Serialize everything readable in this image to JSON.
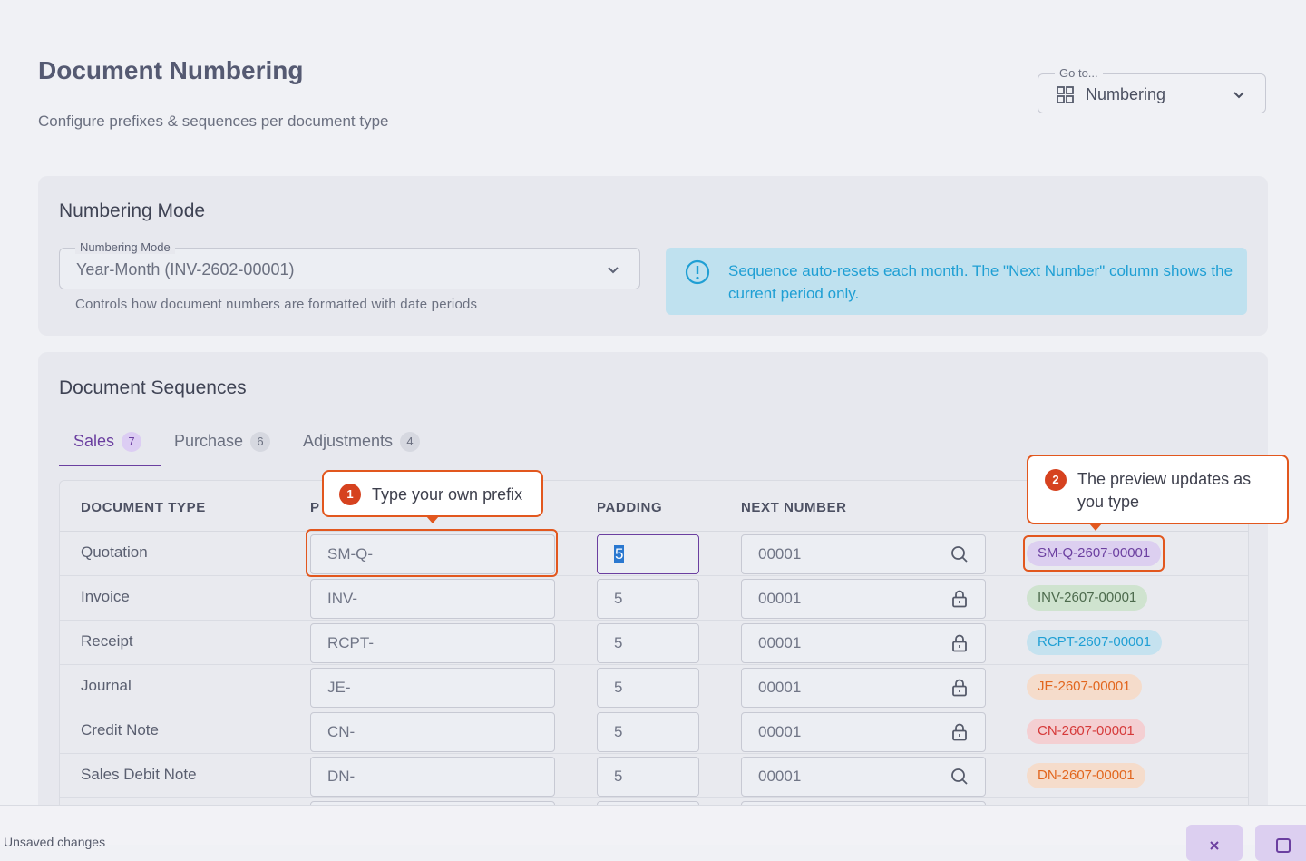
{
  "page": {
    "title": "Document Numbering",
    "subtitle": "Configure prefixes & sequences per document type"
  },
  "goto": {
    "label": "Go to...",
    "value": "Numbering",
    "icon": "grid-icon"
  },
  "numbering_mode": {
    "section_title": "Numbering Mode",
    "field_label": "Numbering Mode",
    "value": "Year-Month (INV-2602-00001)",
    "helper": "Controls how document numbers are formatted with date periods",
    "info_text": "Sequence auto-resets each month. The \"Next Number\" column shows the current period only."
  },
  "sequences": {
    "section_title": "Document Sequences",
    "tabs": [
      {
        "label": "Sales",
        "count": "7",
        "active": true
      },
      {
        "label": "Purchase",
        "count": "6",
        "active": false
      },
      {
        "label": "Adjustments",
        "count": "4",
        "active": false
      }
    ],
    "columns": {
      "document_type": "DOCUMENT TYPE",
      "prefix_partial": "P",
      "padding": "PADDING",
      "next_number": "NEXT NUMBER"
    },
    "rows": [
      {
        "type": "Quotation",
        "prefix": "SM-Q-",
        "padding": "5",
        "next": "00001",
        "icon": "search-icon",
        "preview": "SM-Q-2607-00001",
        "chip_bg": "#dccff0",
        "chip_fg": "#6b3fa0"
      },
      {
        "type": "Invoice",
        "prefix": "INV-",
        "padding": "5",
        "next": "00001",
        "icon": "lock-icon",
        "preview": "INV-2607-00001",
        "chip_bg": "#cfe3cf",
        "chip_fg": "#4d6b4d"
      },
      {
        "type": "Receipt",
        "prefix": "RCPT-",
        "padding": "5",
        "next": "00001",
        "icon": "lock-icon",
        "preview": "RCPT-2607-00001",
        "chip_bg": "#c5e2ef",
        "chip_fg": "#1f9fd4"
      },
      {
        "type": "Journal",
        "prefix": "JE-",
        "padding": "5",
        "next": "00001",
        "icon": "lock-icon",
        "preview": "JE-2607-00001",
        "chip_bg": "#f5dccb",
        "chip_fg": "#e2661e"
      },
      {
        "type": "Credit Note",
        "prefix": "CN-",
        "padding": "5",
        "next": "00001",
        "icon": "lock-icon",
        "preview": "CN-2607-00001",
        "chip_bg": "#f4cfd2",
        "chip_fg": "#d63a3a"
      },
      {
        "type": "Sales Debit Note",
        "prefix": "DN-",
        "padding": "5",
        "next": "00001",
        "icon": "search-icon",
        "preview": "DN-2607-00001",
        "chip_bg": "#f5dccb",
        "chip_fg": "#e2661e"
      }
    ]
  },
  "callouts": [
    {
      "number": "1",
      "text": "Type your own prefix"
    },
    {
      "number": "2",
      "text": "The preview updates as you type"
    }
  ],
  "footer": {
    "status": "Unsaved changes"
  },
  "colors": {
    "accent": "#6b3fa0",
    "callout_border": "#e2571e",
    "info_bg": "#bfe1ef",
    "info_text": "#1f9fd4"
  }
}
